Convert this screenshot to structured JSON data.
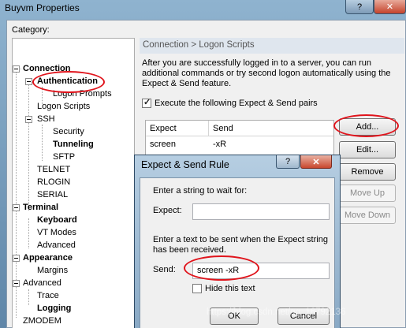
{
  "window": {
    "title": "Buyvm Properties",
    "help_glyph": "?",
    "close_glyph": "✕"
  },
  "category_label": "Category:",
  "tree": {
    "connection": "Connection",
    "authentication": "Authentication",
    "logon_prompts": "Logon Prompts",
    "logon_scripts": "Logon Scripts",
    "ssh": "SSH",
    "security": "Security",
    "tunneling": "Tunneling",
    "sftp": "SFTP",
    "telnet": "TELNET",
    "rlogin": "RLOGIN",
    "serial": "SERIAL",
    "terminal": "Terminal",
    "keyboard": "Keyboard",
    "vt_modes": "VT Modes",
    "advanced_terminal": "Advanced",
    "appearance": "Appearance",
    "margins": "Margins",
    "advanced": "Advanced",
    "trace": "Trace",
    "logging": "Logging",
    "zmodem": "ZMODEM"
  },
  "panel": {
    "breadcrumb": "Connection > Logon Scripts",
    "description": "After you are successfully logged in to a server, you can run additional commands or try second logon automatically using the Expect & Send feature.",
    "execute_label": "Execute the following Expect & Send pairs",
    "execute_checked": true,
    "columns": {
      "expect": "Expect",
      "send": "Send"
    },
    "rows": [
      {
        "expect": "screen",
        "send": "-xR"
      }
    ],
    "buttons": {
      "add": "Add...",
      "edit": "Edit...",
      "remove": "Remove",
      "move_up": "Move Up",
      "move_down": "Move Down"
    }
  },
  "dialog": {
    "title": "Expect & Send Rule",
    "help_glyph": "?",
    "close_glyph": "✕",
    "wait_prompt": "Enter a string to wait for:",
    "expect_label": "Expect:",
    "expect_value": "",
    "send_prompt": "Enter a text to be sent when the Expect string has been received.",
    "send_label": "Send:",
    "send_value": "screen -xR",
    "hide_label": "Hide this text",
    "hide_checked": false,
    "ok": "OK",
    "cancel": "Cancel"
  },
  "watermark": "https://blog.csdn.net/qq_16792136"
}
